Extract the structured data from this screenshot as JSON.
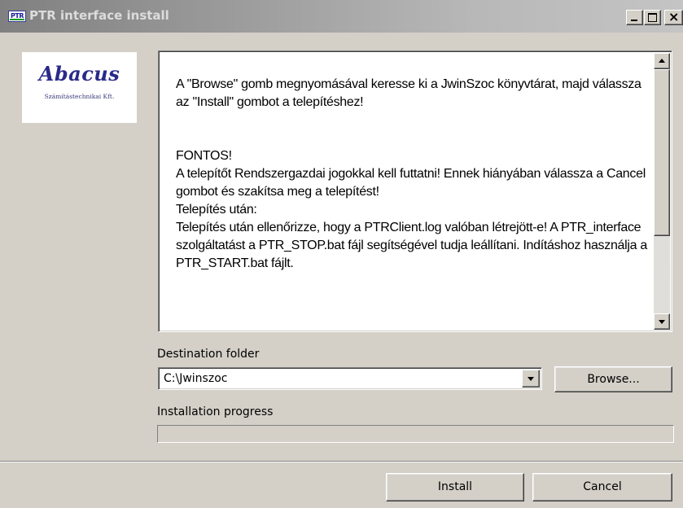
{
  "window": {
    "title": "PTR interface install",
    "icon_text": "PTR",
    "minimize_glyph": "_",
    "maximize_glyph": "□",
    "close_glyph": "×",
    "titlebar_color": "#808080"
  },
  "logo": {
    "name": "Abacus",
    "subtitle": "Számítástechnikai Kft.",
    "color": "#2a2a8a"
  },
  "info_text": {
    "paragraph1": "A \"Browse\" gomb megnyomásával keresse ki a JwinSzoc könyvtárat, majd válassza az \"Install\" gombot a telepítéshez!",
    "line_fontos": "FONTOS!",
    "paragraph2": "A telepítőt Rendszergazdai jogokkal kell futtatni! Ennek hiányában válassza a Cancel gombot és szakítsa meg a telepítést!",
    "line_after": "Telepítés után:",
    "paragraph3": "Telepítés után ellenőrizze, hogy a PTRClient.log valóban létrejött-e! A PTR_interface szolgáltatást a PTR_STOP.bat fájl segítségével tudja leállítani. Indításhoz használja a PTR_START.bat fájlt."
  },
  "destination": {
    "label": "Destination folder",
    "value": "C:\\Jwinszoc",
    "browse_label": "Browse..."
  },
  "progress": {
    "label": "Installation progress",
    "value": 0
  },
  "buttons": {
    "install": "Install",
    "cancel": "Cancel"
  }
}
